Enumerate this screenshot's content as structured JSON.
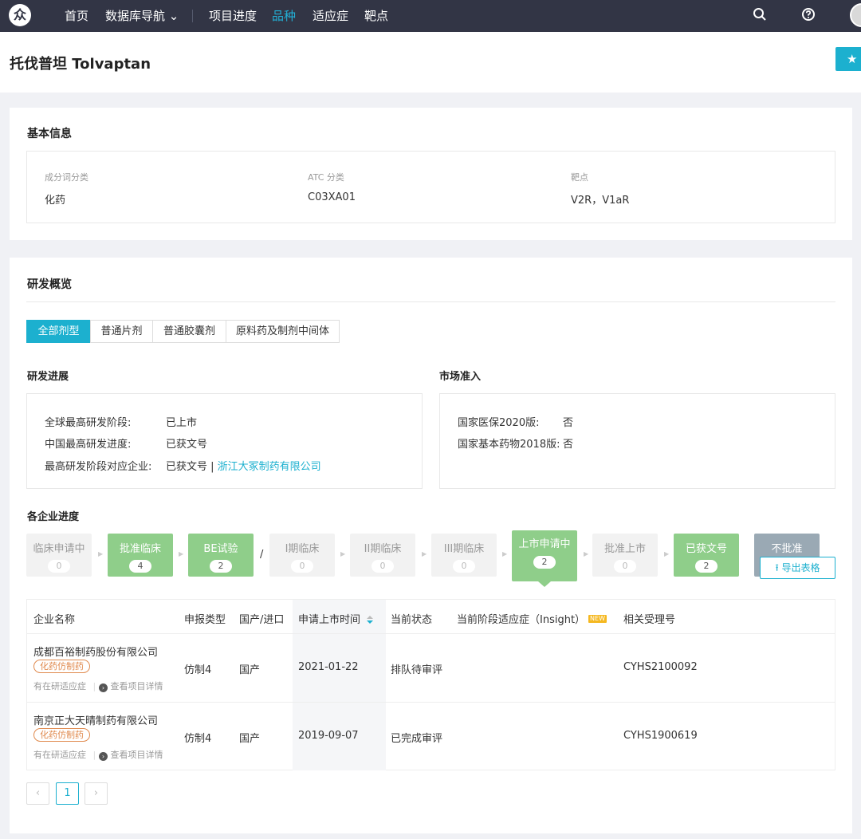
{
  "topbar": {
    "logo_char": "众",
    "nav": [
      "首页",
      "数据库导航 ⌄",
      "项目进度",
      "品种",
      "适应症",
      "靶点"
    ],
    "active_index": 3
  },
  "header": {
    "title": "托伐普坦 Tolvaptan",
    "fav_icon": "★"
  },
  "basic_info": {
    "title": "基本信息",
    "fields": [
      {
        "label": "成分词分类",
        "value": "化药"
      },
      {
        "label": "ATC 分类",
        "value": "C03XA01"
      },
      {
        "label": "靶点",
        "value": "V2R，V1aR"
      }
    ]
  },
  "overview": {
    "title": "研发概览",
    "tabs": [
      "全部剂型",
      "普通片剂",
      "普通胶囊剂",
      "原料药及制剂中间体"
    ],
    "active_tab": 0,
    "progress": {
      "title": "研发进展",
      "rows": [
        {
          "label": "全球最高研发阶段:",
          "value": "已上市"
        },
        {
          "label": "中国最高研发进度:",
          "value": "已获文号"
        },
        {
          "label": "最高研发阶段对应企业:",
          "value": "已获文号 | ",
          "link": "浙江大冢制药有限公司"
        }
      ]
    },
    "market": {
      "title": "市场准入",
      "rows": [
        {
          "label": "国家医保2020版:",
          "value": "否"
        },
        {
          "label": "国家基本药物2018版:",
          "value": "否"
        }
      ]
    },
    "company_progress": {
      "title": "各企业进度",
      "stages": [
        {
          "label": "临床申请中",
          "count": "0"
        },
        {
          "label": "批准临床",
          "count": "4"
        },
        {
          "label": "BE试验",
          "count": "2"
        },
        {
          "label": "I期临床",
          "count": "0"
        },
        {
          "label": "II期临床",
          "count": "0"
        },
        {
          "label": "III期临床",
          "count": "0"
        },
        {
          "label": "上市申请中",
          "count": "2"
        },
        {
          "label": "批准上市",
          "count": "0"
        },
        {
          "label": "已获文号",
          "count": "2"
        },
        {
          "label": "不批准",
          "count": ""
        }
      ],
      "slash": "/",
      "export_label": "导出表格"
    },
    "table": {
      "headers": [
        "企业名称",
        "申报类型",
        "国产/进口",
        "申请上市时间",
        "当前状态",
        "当前阶段适应症（Insight）",
        "相关受理号"
      ],
      "new_badge": "NEW",
      "rows": [
        {
          "company": "成都百裕制药股份有限公司",
          "tag": "化药仿制药",
          "link1": "有在研适应症",
          "link2": "查看项目详情",
          "type": "仿制4",
          "origin": "国产",
          "date": "2021-01-22",
          "status": "排队待审评",
          "indication": "",
          "acceptance_no": "CYHS2100092"
        },
        {
          "company": "南京正大天晴制药有限公司",
          "tag": "化药仿制药",
          "link1": "有在研适应症",
          "link2": "查看项目详情",
          "type": "仿制4",
          "origin": "国产",
          "date": "2019-09-07",
          "status": "已完成审评",
          "indication": "",
          "acceptance_no": "CYHS1900619"
        }
      ]
    },
    "pagination": {
      "prev": "‹",
      "current": "1",
      "next": "›"
    }
  },
  "colors": {
    "accent": "#1cb0cf",
    "topbar": "#323545",
    "stage_active": "#8fce8a",
    "stage_reject": "#9aa9b4",
    "tag": "#e08a4e"
  }
}
